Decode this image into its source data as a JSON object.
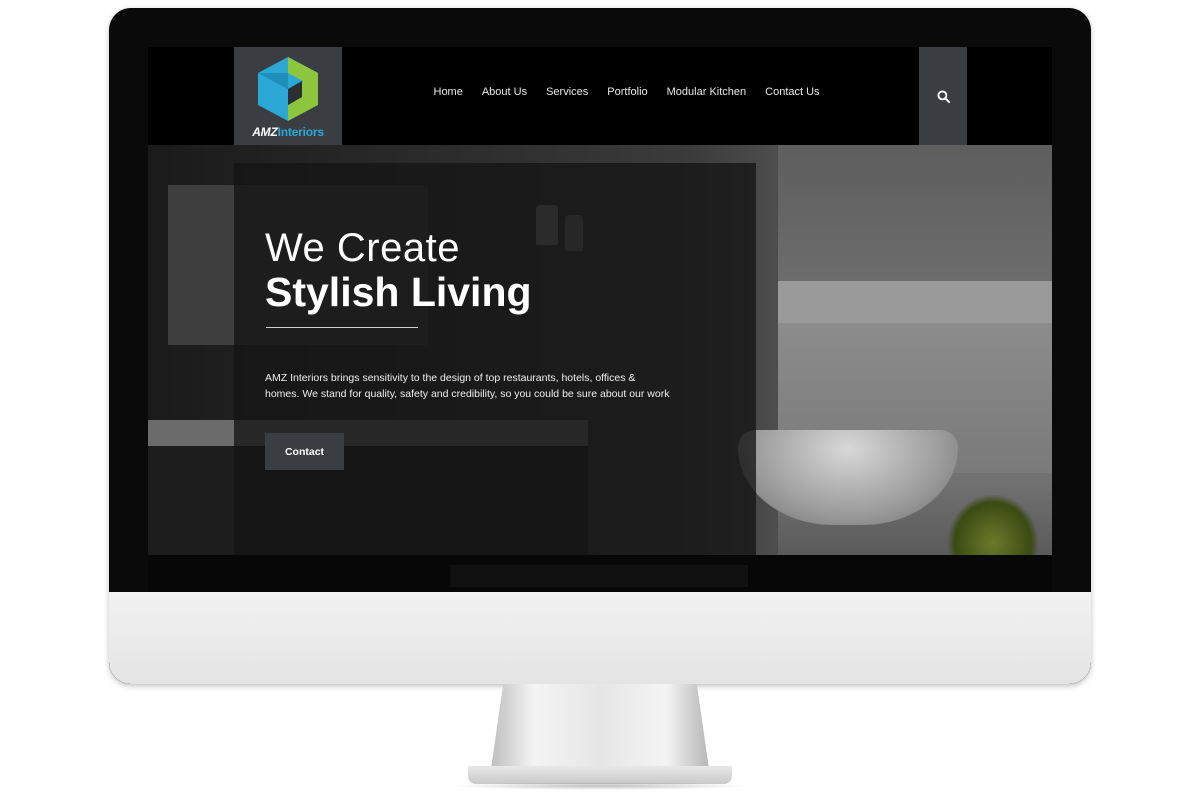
{
  "brand": {
    "logo_word_1": "AMZ",
    "logo_word_2": "Interiors",
    "logo_colors": [
      "#8cc63f",
      "#2ba8d6",
      "#3a3d42"
    ]
  },
  "nav": {
    "items": [
      {
        "label": "Home"
      },
      {
        "label": "About Us"
      },
      {
        "label": "Services"
      },
      {
        "label": "Portfolio"
      },
      {
        "label": "Modular Kitchen"
      },
      {
        "label": "Contact Us"
      }
    ],
    "search_icon": "search-icon"
  },
  "hero": {
    "title_light": "We Create",
    "title_bold": "Stylish Living",
    "description": "AMZ Interiors brings sensitivity to the design of top restaurants, hotels, offices & homes. We stand for quality, safety and credibility, so you could be sure about our work",
    "cta_label": "Contact"
  },
  "colors": {
    "accent_panel": "#3a3d42",
    "background": "#000000",
    "text": "#ffffff"
  }
}
